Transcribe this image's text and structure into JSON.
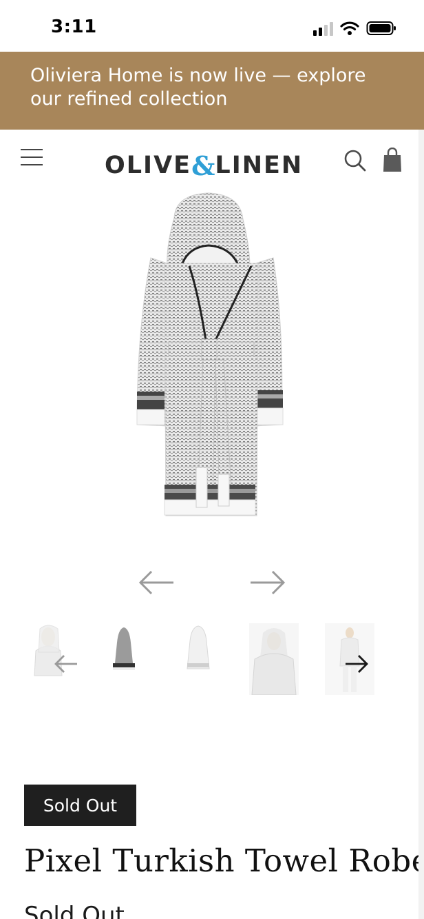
{
  "status_bar": {
    "time": "3:11",
    "icons": [
      "cellular-signal-icon",
      "wifi-icon",
      "battery-icon"
    ]
  },
  "announcement": {
    "text": "Oliviera Home is now live — explore our refined collection",
    "background": "#a8865a"
  },
  "header": {
    "logo_left": "OLIVE",
    "logo_amp": "&",
    "logo_right": "LINEN",
    "logo_accent": "#2f9fd6",
    "icons": [
      "menu-icon",
      "search-icon",
      "shopping-bag-icon"
    ]
  },
  "gallery": {
    "main_image": "hooded-turkish-towel-robe",
    "prev_icon": "arrow-left-icon",
    "next_icon": "arrow-right-icon",
    "thumbnails": [
      "model-wearing-robe-hood-up",
      "robe-front-dark-stripes",
      "robe-front-white",
      "model-holding-robe-collar",
      "model-full-length-robe"
    ]
  },
  "product": {
    "badge": "Sold Out",
    "title": "Pixel Turkish Towel Robe",
    "price_status": "Sold Out"
  }
}
